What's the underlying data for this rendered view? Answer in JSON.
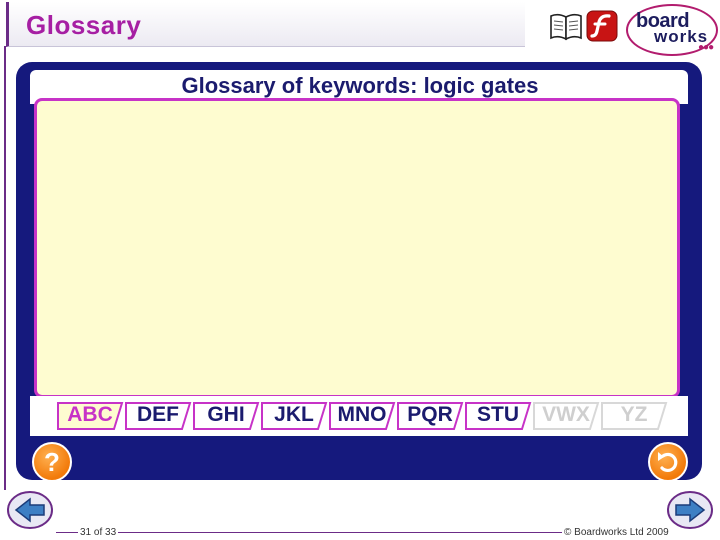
{
  "header": {
    "title": "Glossary",
    "logo_line1": "board",
    "logo_line2": "works",
    "logo_dots": "●●●",
    "icons": [
      "book-icon",
      "flash-icon"
    ]
  },
  "panel": {
    "heading": "Glossary of keywords: logic gates",
    "tabs": [
      {
        "label": "ABC",
        "state": "active"
      },
      {
        "label": "DEF",
        "state": "normal"
      },
      {
        "label": "GHI",
        "state": "normal"
      },
      {
        "label": "JKL",
        "state": "normal"
      },
      {
        "label": "MNO",
        "state": "normal"
      },
      {
        "label": "PQR",
        "state": "normal"
      },
      {
        "label": "STU",
        "state": "normal"
      },
      {
        "label": "VWX",
        "state": "disabled"
      },
      {
        "label": "YZ",
        "state": "disabled"
      }
    ],
    "help_label": "?"
  },
  "footer": {
    "slide_counter": "31 of 33",
    "copyright": "© Boardworks Ltd 2009"
  },
  "colors": {
    "panel": "#15197d",
    "accent": "#c733c7",
    "content_bg": "#fefcd0",
    "button_orange": "#f27a0a",
    "title_magenta": "#a61fa3"
  }
}
